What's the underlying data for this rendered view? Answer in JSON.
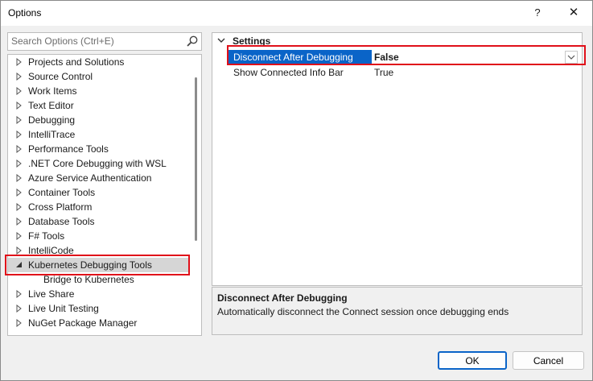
{
  "window": {
    "title": "Options",
    "help_label": "?",
    "close_label": "✕"
  },
  "search": {
    "placeholder": "Search Options (Ctrl+E)"
  },
  "tree": {
    "items": [
      {
        "label": "Projects and Solutions",
        "expanded": false
      },
      {
        "label": "Source Control",
        "expanded": false
      },
      {
        "label": "Work Items",
        "expanded": false
      },
      {
        "label": "Text Editor",
        "expanded": false
      },
      {
        "label": "Debugging",
        "expanded": false
      },
      {
        "label": "IntelliTrace",
        "expanded": false
      },
      {
        "label": "Performance Tools",
        "expanded": false
      },
      {
        "label": ".NET Core Debugging with WSL",
        "expanded": false
      },
      {
        "label": "Azure Service Authentication",
        "expanded": false
      },
      {
        "label": "Container Tools",
        "expanded": false
      },
      {
        "label": "Cross Platform",
        "expanded": false
      },
      {
        "label": "Database Tools",
        "expanded": false
      },
      {
        "label": "F# Tools",
        "expanded": false
      },
      {
        "label": "IntelliCode",
        "expanded": false
      },
      {
        "label": "Kubernetes Debugging Tools",
        "expanded": true,
        "selected": true
      },
      {
        "label": "Bridge to Kubernetes",
        "child": true
      },
      {
        "label": "Live Share",
        "expanded": false
      },
      {
        "label": "Live Unit Testing",
        "expanded": false
      },
      {
        "label": "NuGet Package Manager",
        "expanded": false
      }
    ]
  },
  "settings": {
    "category": "Settings",
    "properties": [
      {
        "name": "Disconnect After Debugging",
        "value": "False",
        "selected": true
      },
      {
        "name": "Show Connected Info Bar",
        "value": "True"
      }
    ]
  },
  "description": {
    "title": "Disconnect After Debugging",
    "text": "Automatically disconnect the Connect session once debugging ends"
  },
  "buttons": {
    "ok": "OK",
    "cancel": "Cancel"
  },
  "colors": {
    "accent": "#0a64c8",
    "highlight": "#e0101a"
  }
}
